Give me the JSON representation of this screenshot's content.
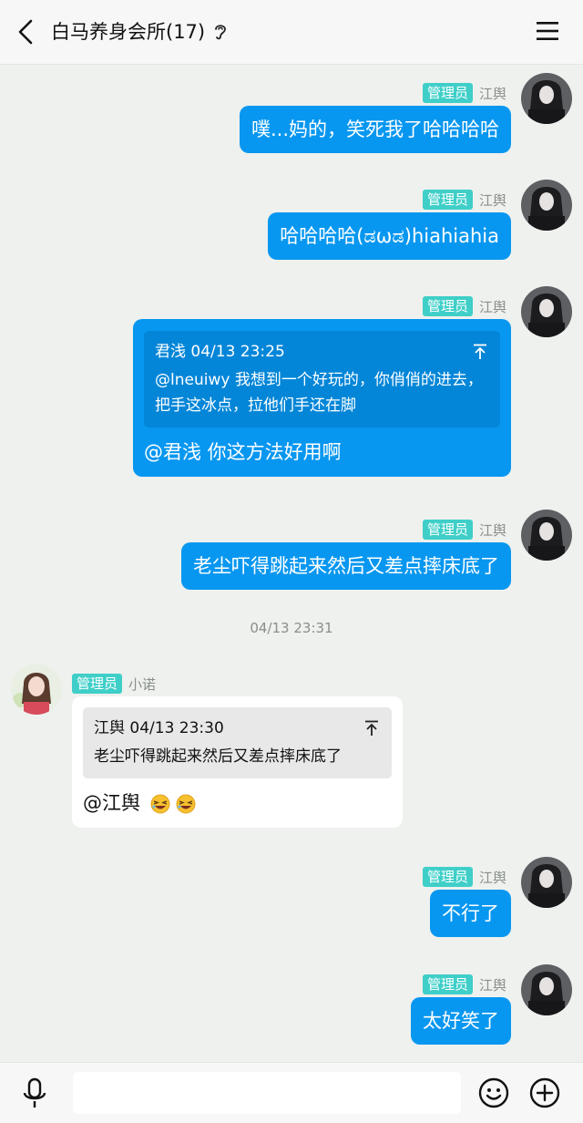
{
  "header": {
    "title": "白马养身会所(17)",
    "back_icon": "back-arrow-icon",
    "ear_icon": "ear-icon",
    "menu_icon": "menu-icon"
  },
  "messages": [
    {
      "side": "right",
      "badge": "管理员",
      "nick": "江舆",
      "text": "噗...妈的，笑死我了哈哈哈哈"
    },
    {
      "side": "right",
      "badge": "管理员",
      "nick": "江舆",
      "text": "哈哈哈哈(ಡωಡ)hiahiahia"
    },
    {
      "side": "right",
      "badge": "管理员",
      "nick": "江舆",
      "quote_head": "君浅 04/13 23:25",
      "quote_text": "@lneuiwy 我想到一个好玩的，你俏俏的进去，把手这冰点，拉他们手还在脚",
      "text": "@君浅 你这方法好用啊"
    },
    {
      "side": "right",
      "badge": "管理员",
      "nick": "江舆",
      "text": "老尘吓得跳起来然后又差点摔床底了"
    },
    {
      "side": "left",
      "badge": "管理员",
      "nick": "小诺",
      "quote_head": "江舆 04/13 23:30",
      "quote_text": "老尘吓得跳起来然后又差点摔床底了",
      "text": "@江舆"
    },
    {
      "side": "right",
      "badge": "管理员",
      "nick": "江舆",
      "text": "不行了"
    },
    {
      "side": "right",
      "badge": "管理员",
      "nick": "江舆",
      "text": "太好笑了"
    }
  ],
  "timestamp": "04/13 23:31",
  "bottom_bar": {
    "input_value": "",
    "mic_icon": "microphone-icon",
    "emoji_icon": "emoji-icon",
    "plus_icon": "plus-icon"
  }
}
